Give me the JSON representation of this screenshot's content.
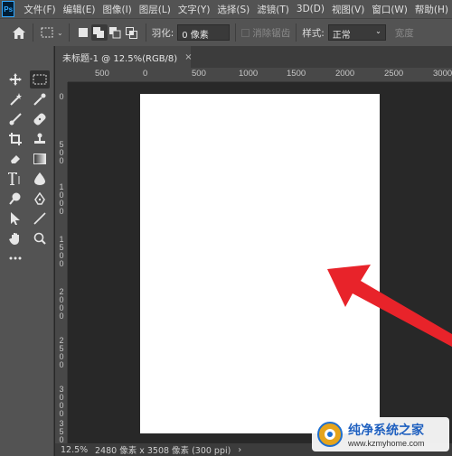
{
  "app": {
    "logo_text": "Ps"
  },
  "menu": [
    "文件(F)",
    "编辑(E)",
    "图像(I)",
    "图层(L)",
    "文字(Y)",
    "选择(S)",
    "滤镜(T)",
    "3D(D)",
    "视图(V)",
    "窗口(W)",
    "帮助(H)"
  ],
  "options": {
    "feather_label": "羽化:",
    "feather_value": "0 像素",
    "antialias_label": "消除锯齿",
    "style_label": "样式:",
    "style_value": "正常",
    "width_label": "宽度"
  },
  "tools": [
    "move-tool-icon",
    "marquee-tool-icon",
    "magic-wand-icon",
    "eyedropper-icon",
    "brush-icon",
    "healing-brush-icon",
    "crop-icon",
    "stamp-icon",
    "eraser-icon",
    "gradient-icon",
    "type-tool-icon",
    "blur-drop-icon",
    "dodge-icon",
    "pen-icon",
    "path-select-icon",
    "line-icon",
    "hand-icon",
    "zoom-icon",
    "more-tools-icon"
  ],
  "document": {
    "tab_title": "未标题-1 @ 12.5%(RGB/8)",
    "tab_close": "×"
  },
  "rulers": {
    "horizontal": [
      "500",
      "0",
      "500",
      "1000",
      "1500",
      "2000",
      "2500",
      "3000"
    ],
    "vertical": [
      "0",
      "500",
      "1000",
      "1500",
      "2000",
      "2500",
      "3000",
      "3500"
    ]
  },
  "status": {
    "zoom": "12.5%",
    "info": "2480 像素 x 3508 像素 (300 ppi)",
    "arrow": "›"
  },
  "watermark": {
    "title": "纯净系统之家",
    "url": "www.kzmyhome.com"
  },
  "colors": {
    "chrome": "#535353",
    "workspace": "#282828",
    "canvas": "#ffffff",
    "annotation_arrow": "#e8232a"
  }
}
